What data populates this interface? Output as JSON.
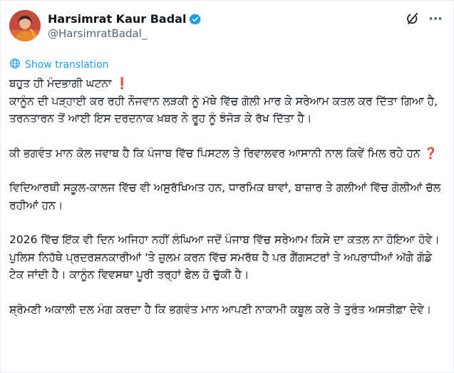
{
  "author": {
    "display_name": "Harsimrat Kaur Badal",
    "handle": "@HarsimratBadal_",
    "verified": true
  },
  "actions": {
    "translate_label": "Show translation"
  },
  "icons": {
    "verified": "verified-badge-icon",
    "grok": "grok-icon",
    "more": "more-options-icon",
    "translate": "globe-icon"
  },
  "colors": {
    "link": "#1d9bf0",
    "handle": "#536471",
    "emoji_red": "#d0021b"
  },
  "tweet": {
    "p1_l1": "ਬਹੁਤ ਹੀ ਮੰਦਭਾਗੀ ਘਟਨਾ",
    "p1_emoji": "❗",
    "p1_l2": "ਕਾਨੂੰਨ ਦੀ ਪੜ੍ਹਾਈ ਕਰ ਰਹੀ ਨੌਜਵਾਨ ਲੜਕੀ ਨੂੰ ਮੱਥੇ ਵਿੱਚ ਗੋਲੀ ਮਾਰ ਕੇ ਸਰੇਆਮ ਕਤਲ ਕਰ ਦਿੱਤਾ ਗਿਆ ਹੈ, ਤਰਨਤਾਰਨ ਤੋਂ ਆਈ ਇਸ ਦਰਦਨਾਕ ਖ਼ਬਰ ਨੇ ਰੂਹ ਨੂੰ ਝੰਜੋੜ ਕੇ ਰੱਖ ਦਿੱਤਾ ਹੈ।",
    "p2": "ਕੀ ਭਗਵੰਤ ਮਾਨ ਕੋਲ ਜਵਾਬ ਹੈ ਕਿ ਪੰਜਾਬ ਵਿੱਚ ਪਿਸਟਲ ਤੇ ਰਿਵਾਲਵਰ ਆਸਾਨੀ ਨਾਲ ਕਿਵੇਂ ਮਿਲ ਰਹੇ ਹਨ",
    "p2_emoji": "❓",
    "p3": "ਵਿਦਿਆਰਥੀ ਸਕੂਲ-ਕਾਲਜ ਵਿੱਚ ਵੀ ਅਸੁਰੱਖਿਅਤ ਹਨ, ਧਾਰਮਿਕ ਥਾਵਾਂ, ਬਾਜ਼ਾਰ ਤੇ ਗਲੀਆਂ ਵਿੱਚ ਗੋਲੀਆਂ ਚੱਲ ਰਹੀਆਂ ਹਨ।",
    "p4": "2026 ਵਿੱਚ ਇੱਕ ਵੀ ਦਿਨ ਅਜਿਹਾ ਨਹੀਂ ਲੰਘਿਆ ਜਦੋਂ ਪੰਜਾਬ ਵਿੱਚ ਸਰੇਆਮ ਕਿਸੇ ਦਾ ਕਤਲ ਨਾ ਹੋਇਆ ਹੋਵੇ। ਪੁਲਿਸ ਨਿਹੱਥੇ ਪ੍ਰਦਰਸ਼ਨਕਾਰੀਆਂ 'ਤੇ ਜ਼ੁਲਮ ਕਰਨ ਵਿੱਚ ਸਮਰੱਥ ਹੈ ਪਰ ਗੈਂਗਸਟਰਾਂ ਤੇ ਅਪਰਾਧੀਆਂ ਅੱਗੇ ਗੋਡੇ ਟੇਕ ਜਾਂਦੀ ਹੈ। ਕਾਨੂੰਨ ਵਿਵਸਥਾ ਪੂਰੀ ਤਰ੍ਹਾਂ ਫੇਲ ਹੋ ਚੁੱਕੀ ਹੈ।",
    "p5": "ਸ਼੍ਰੋਮਣੀ ਅਕਾਲੀ ਦਲ ਮੰਗ ਕਰਦਾ ਹੈ ਕਿ ਭਗਵੰਤ ਮਾਨ ਆਪਣੀ ਨਾਕਾਮੀ ਕਬੂਲ ਕਰੇ ਤੇ ਤੁਰੰਤ ਅਸਤੀਫ਼ਾ ਦੇਵੇ।"
  }
}
